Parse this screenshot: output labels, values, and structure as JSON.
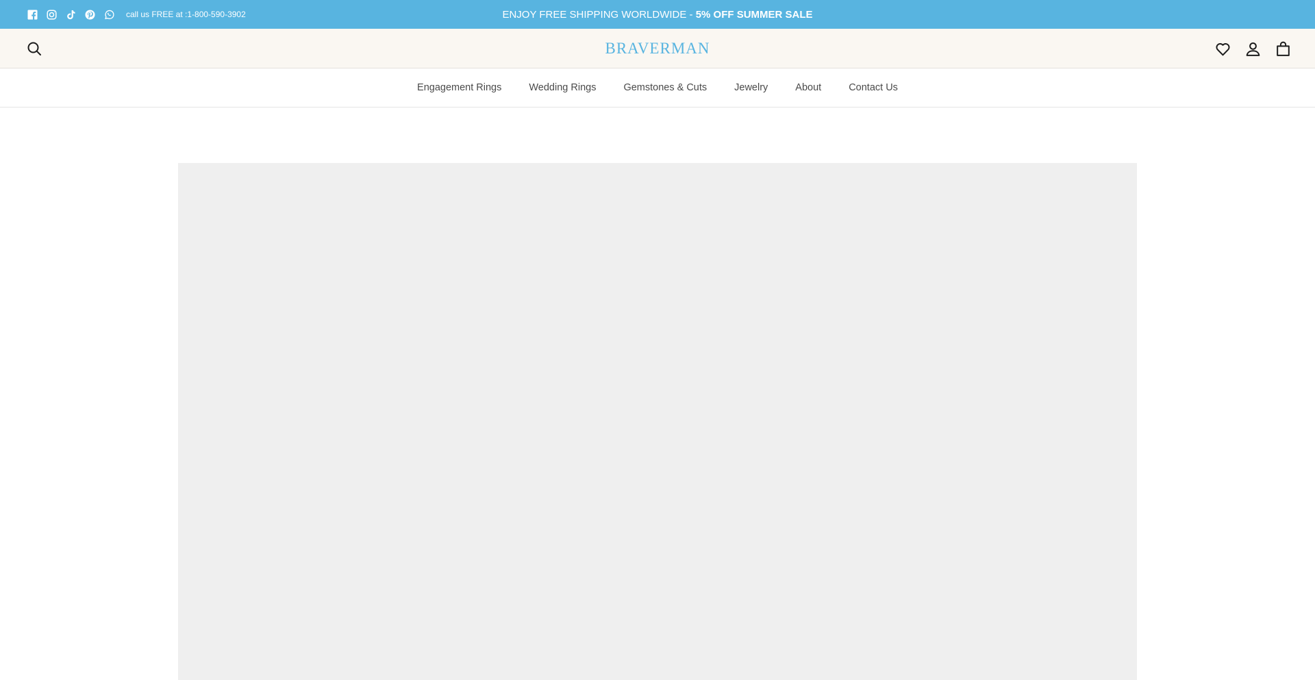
{
  "announcement": {
    "social": [
      {
        "name": "facebook-icon"
      },
      {
        "name": "instagram-icon"
      },
      {
        "name": "tiktok-icon"
      },
      {
        "name": "pinterest-icon"
      },
      {
        "name": "whatsapp-icon"
      }
    ],
    "phone_text": "call us FREE at :1-800-590-3902",
    "promo_text": "ENJOY FREE SHIPPING WORLDWIDE - ",
    "promo_bold": "5% OFF SUMMER SALE",
    "bg_color": "#58b4e0"
  },
  "header": {
    "logo_text": "BRAVERMAN",
    "icons": {
      "search": "search-icon",
      "wishlist": "heart-icon",
      "account": "user-icon",
      "cart": "bag-icon"
    },
    "bg_color": "#faf7f2",
    "brand_color": "#58b4e0"
  },
  "nav": {
    "items": [
      {
        "label": "Engagement Rings"
      },
      {
        "label": "Wedding Rings"
      },
      {
        "label": "Gemstones & Cuts"
      },
      {
        "label": "Jewelry"
      },
      {
        "label": "About"
      },
      {
        "label": "Contact Us"
      }
    ]
  }
}
